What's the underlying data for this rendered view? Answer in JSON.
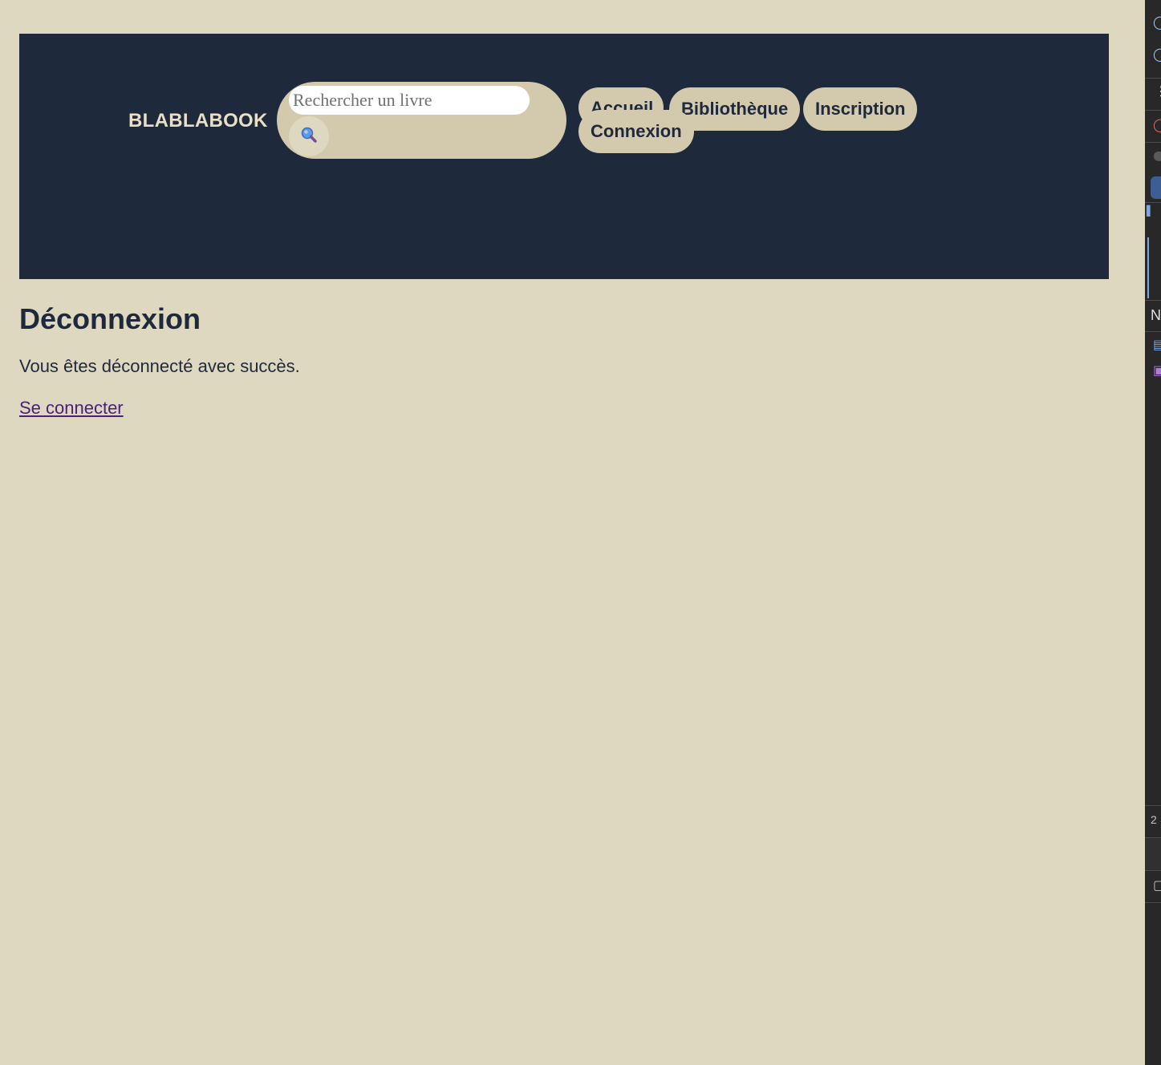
{
  "header": {
    "logo_text": "BLABLABOOK",
    "search": {
      "placeholder": "Rechercher un livre",
      "value": ""
    },
    "nav": {
      "home": "Accueil",
      "library": "Bibliothèque",
      "signup": "Inscription",
      "login": "Connexion"
    }
  },
  "main": {
    "title": "Déconnexion",
    "message": "Vous êtes déconnecté avec succès.",
    "login_link": "Se connecter"
  },
  "devtools": {
    "partial_letter": "N",
    "partial_digit": "2"
  },
  "colors": {
    "page_background": "#dfd8c1",
    "header_background": "#1e293b",
    "pill_background": "#d3c9ad",
    "text_dark": "#1e293b",
    "link_visited": "#4b1f7a"
  }
}
